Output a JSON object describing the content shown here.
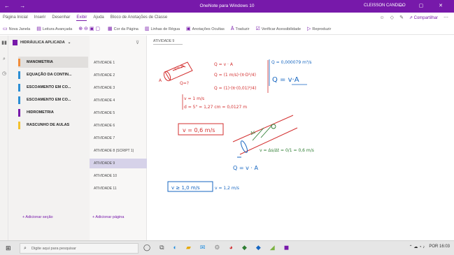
{
  "titlebar": {
    "nav": "← →",
    "title": "OneNote para Windows 10",
    "user": "CLEISSON CANDIDO",
    "window_controls": "— ▢ ✕"
  },
  "menu": {
    "items": [
      "Página Inicial",
      "Inserir",
      "Desenhar",
      "Exibir",
      "Ajuda",
      "Bloco de Anotações de Classe"
    ],
    "active_index": 3,
    "share": "Compartilhar"
  },
  "ribbon": {
    "items": [
      "Nova Janela",
      "Leitura Avançada",
      "Cor da Página",
      "Linhas de Régua",
      "Anotações Ocultas",
      "Traduzir",
      "Verificar Acessibilidade",
      "Reproduzir"
    ]
  },
  "notebook": {
    "name": "HIDRÁULICA APLICADA",
    "sections": [
      {
        "label": "MANOMETRIA",
        "color": "#f08c3a",
        "selected": true
      },
      {
        "label": "EQUAÇÃO DA CONTIN...",
        "color": "#2b8ed4",
        "selected": false
      },
      {
        "label": "ESCOAMENTO EM CO...",
        "color": "#2b8ed4",
        "selected": false
      },
      {
        "label": "ESCOAMENTO EM CO...",
        "color": "#2b8ed4",
        "selected": false
      },
      {
        "label": "HIDROMETRIA",
        "color": "#7719aa",
        "selected": false
      },
      {
        "label": "RASCUNHO DE AULAS",
        "color": "#f2c12e",
        "selected": false
      }
    ],
    "add_section": "+ Adicionar seção"
  },
  "pages": {
    "items": [
      {
        "label": "ATIVIDADE 1",
        "selected": false
      },
      {
        "label": "ATIVIDADE 2",
        "selected": false
      },
      {
        "label": "ATIVIDADE 3",
        "selected": false
      },
      {
        "label": "ATIVIDADE 4",
        "selected": false
      },
      {
        "label": "ATIVIDADE 5",
        "selected": false
      },
      {
        "label": "ATIVIDADE 6",
        "selected": false
      },
      {
        "label": "ATIVIDADE 7",
        "selected": false
      },
      {
        "label": "ATIVIDADE 8 (SCRIPT 1)",
        "selected": false
      },
      {
        "label": "ATIVIDADE 9",
        "selected": true
      },
      {
        "label": "ATIVIDADE 10",
        "selected": false
      },
      {
        "label": "ATIVIDADE 11",
        "selected": false
      }
    ],
    "add_page": "+ Adicionar página"
  },
  "canvas": {
    "page_title": "ATIVIDADE 9",
    "ink": {
      "q_va": "Q = v · A",
      "q_formula": "Q = (1 m/s)·(π·D²/4)",
      "q_result": "Q = (1)·(π·(0,01)²/4)",
      "q_value": "Q = 0,000079 m³/s",
      "q_boxed": "Q = v·A",
      "v_eq": "v = 1 m/s",
      "d_eq": "d = 5\" = 1,27 cm = 0,0127 m",
      "v_box": "v = 0,6 m/s",
      "v_formula": "v = Δs/Δt = 0/1 = 0,6 m/s",
      "q_bottom": "Q = v · A",
      "v_ge": "v ≥ 1,0 m/s",
      "v_12": "v = 1,2 m/s"
    }
  },
  "taskbar": {
    "search_placeholder": "Digite aqui para pesquisar",
    "tray": "POR 16:03"
  }
}
